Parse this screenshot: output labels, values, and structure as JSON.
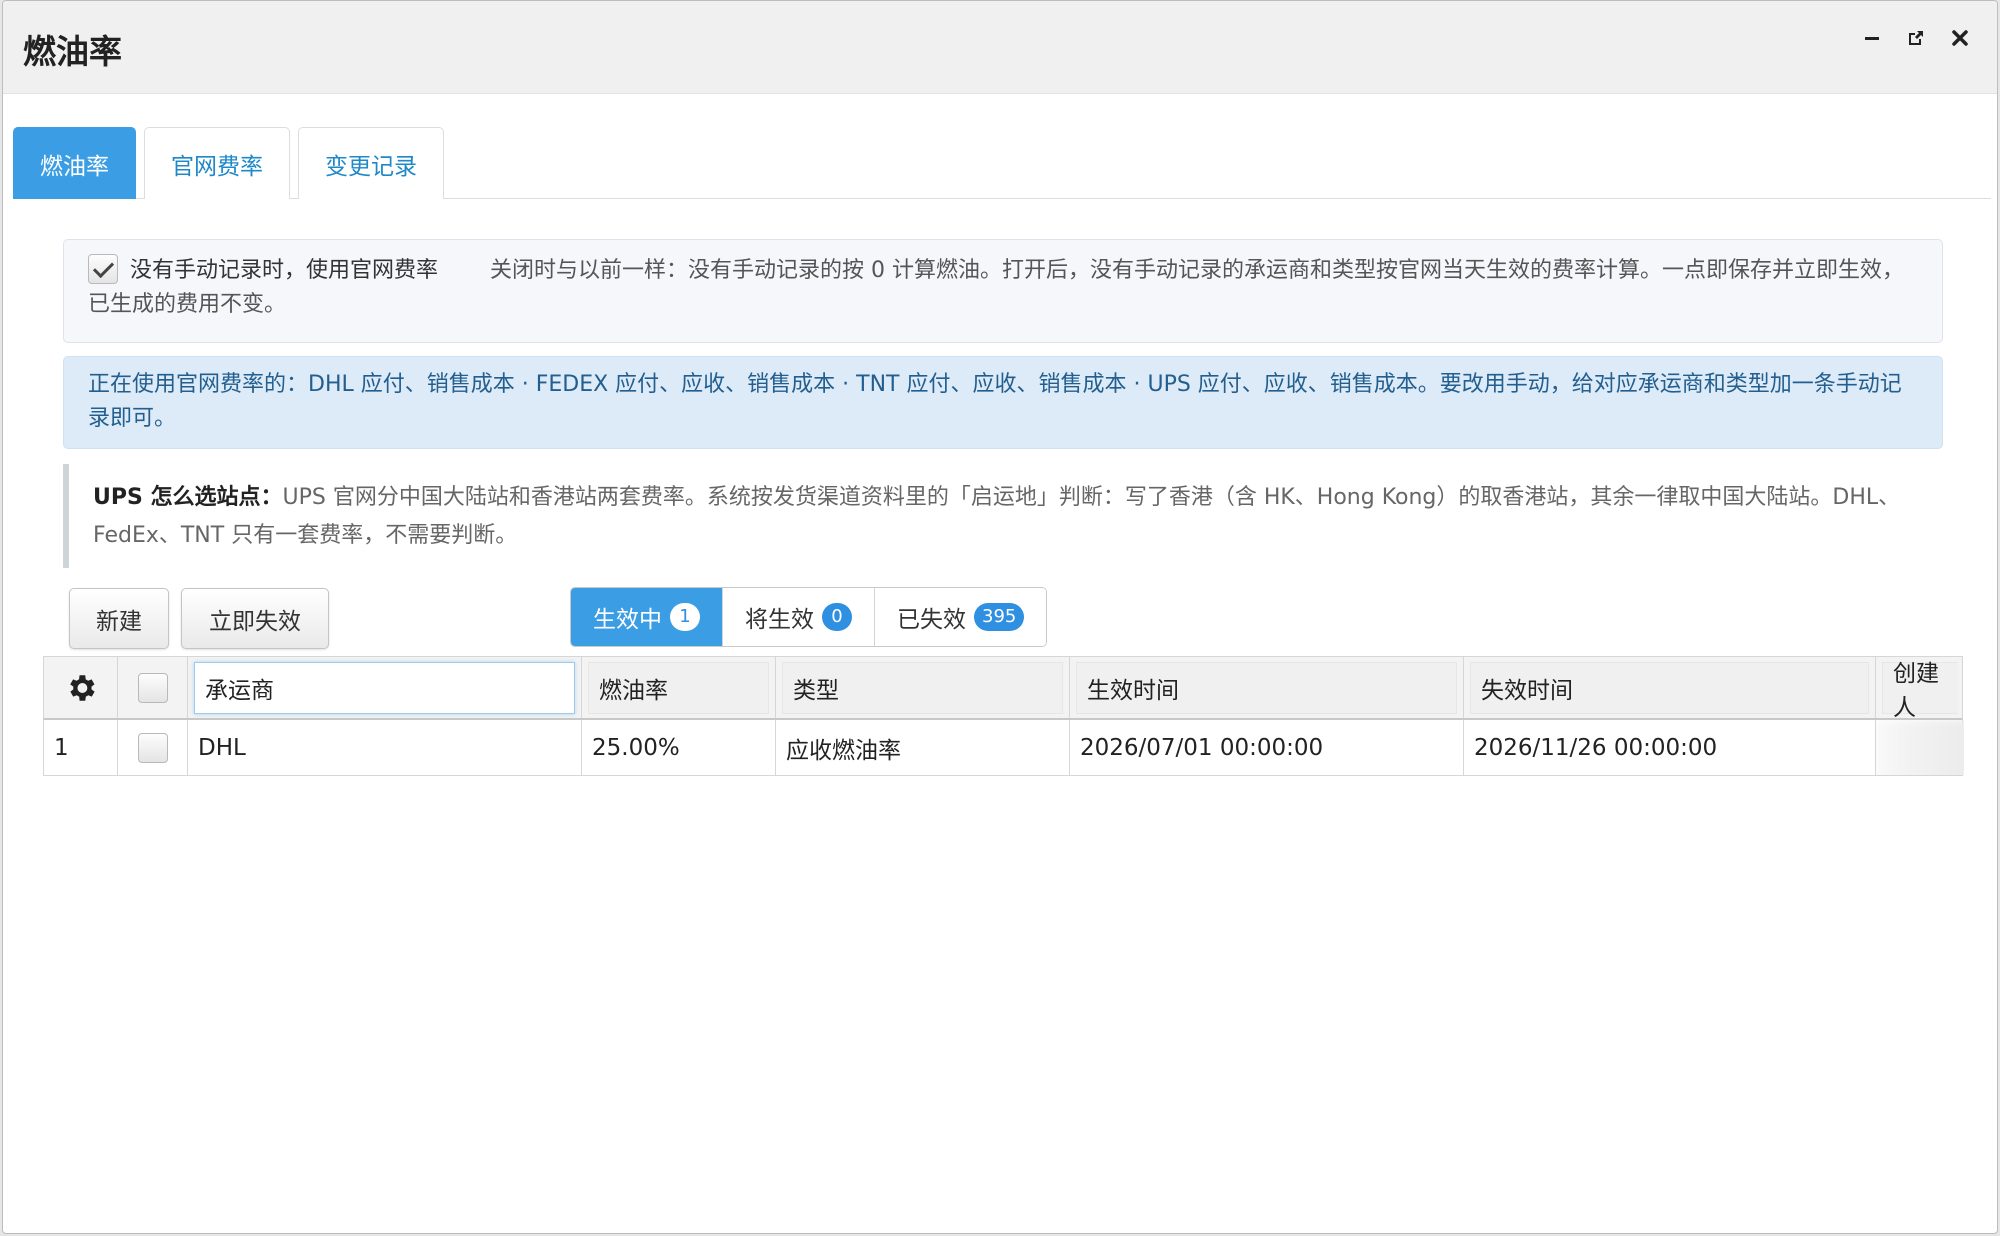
{
  "window": {
    "title": "燃油率"
  },
  "tabs": [
    {
      "label": "燃油率",
      "active": true
    },
    {
      "label": "官网费率",
      "active": false
    },
    {
      "label": "变更记录",
      "active": false
    }
  ],
  "option": {
    "checked": true,
    "label": "没有手动记录时，使用官网费率",
    "description": "关闭时与以前一样：没有手动记录的按 0 计算燃油。打开后，没有手动记录的承运商和类型按官网当天生效的费率计算。一点即保存并立即生效，已生成的费用不变。"
  },
  "info": {
    "text": "正在使用官网费率的：DHL 应付、销售成本 · FEDEX 应付、应收、销售成本 · TNT 应付、应收、销售成本 · UPS 应付、应收、销售成本。要改用手动，给对应承运商和类型加一条手动记录即可。"
  },
  "note": {
    "title": "UPS 怎么选站点：",
    "text": "UPS 官网分中国大陆站和香港站两套费率。系统按发货渠道资料里的「启运地」判断：写了香港（含 HK、Hong Kong）的取香港站，其余一律取中国大陆站。DHL、FedEx、TNT 只有一套费率，不需要判断。"
  },
  "toolbar": {
    "new_label": "新建",
    "expire_label": "立即失效"
  },
  "status_filter": [
    {
      "label": "生效中",
      "count": "1",
      "active": true
    },
    {
      "label": "将生效",
      "count": "0",
      "active": false
    },
    {
      "label": "已失效",
      "count": "395",
      "active": false
    }
  ],
  "table": {
    "columns": [
      "承运商",
      "燃油率",
      "类型",
      "生效时间",
      "失效时间",
      "创建人"
    ],
    "rows": [
      {
        "index": "1",
        "carrier": "DHL",
        "rate": "25.00%",
        "type": "应收燃油率",
        "start": "2026/07/01 00:00:00",
        "end": "2026/11/26 00:00:00"
      }
    ]
  }
}
